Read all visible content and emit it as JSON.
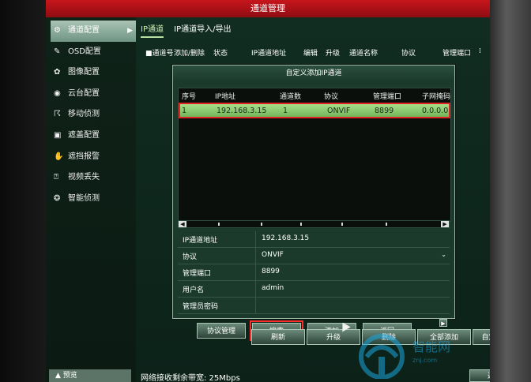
{
  "window": {
    "title": "通道管理"
  },
  "sidebar": {
    "items": [
      {
        "label": "通道配置",
        "icon": "gear-icon"
      },
      {
        "label": "OSD配置",
        "icon": "wrench-icon"
      },
      {
        "label": "图像配置",
        "icon": "palette-icon"
      },
      {
        "label": "云台配置",
        "icon": "ptz-icon"
      },
      {
        "label": "移动侦测",
        "icon": "motion-icon"
      },
      {
        "label": "遮盖配置",
        "icon": "mask-icon"
      },
      {
        "label": "遮挡报警",
        "icon": "hand-icon"
      },
      {
        "label": "视频丢失",
        "icon": "video-icon"
      },
      {
        "label": "智能侦测",
        "icon": "smart-icon"
      }
    ],
    "footer_label": "预览"
  },
  "tabs": [
    {
      "label": "IP通道",
      "active": true
    },
    {
      "label": "IP通道导入/导出",
      "active": false
    }
  ],
  "channel_table_header": {
    "channel": "■通道号",
    "add_delete": "添加/删除",
    "status": "状态",
    "ip": "IP通道地址",
    "edit": "编辑",
    "upgrade": "升级",
    "name": "通道名称",
    "protocol": "协议",
    "mgmt_port": "管理端口",
    "more": "⁞"
  },
  "dialog": {
    "title": "自定义添加IP通道",
    "columns": [
      "序号",
      "IP地址",
      "通道数",
      "协议",
      "管理端口",
      "子网掩码"
    ],
    "rows": [
      {
        "seq": "1",
        "ip": "192.168.3.15",
        "channels": "1",
        "protocol": "ONVIF",
        "port": "8899",
        "mask": "0.0.0.0"
      }
    ],
    "form": {
      "ip_label": "IP通道地址",
      "ip_value": "192.168.3.15",
      "protocol_label": "协议",
      "protocol_value": "ONVIF",
      "port_label": "管理端口",
      "port_value": "8899",
      "user_label": "用户名",
      "user_value": "admin",
      "pwd_label": "管理员密码",
      "pwd_value": ""
    },
    "buttons": {
      "protocol_mgmt": "协议管理",
      "search": "搜索",
      "add": "添加",
      "back": "返回"
    }
  },
  "bottom": {
    "refresh": "刷新",
    "upgrade": "升级",
    "delete": "删除",
    "add_all": "全部添加",
    "custom_add": "自定义添加",
    "back": "返回",
    "status": "网络接收剩余带宽: 25Mbps"
  },
  "watermark": {
    "text": "智能网",
    "sub": "znj.com"
  },
  "colors": {
    "title_bar": "#b5121b",
    "selected_row": "#8fce72",
    "highlight": "#e02424"
  }
}
